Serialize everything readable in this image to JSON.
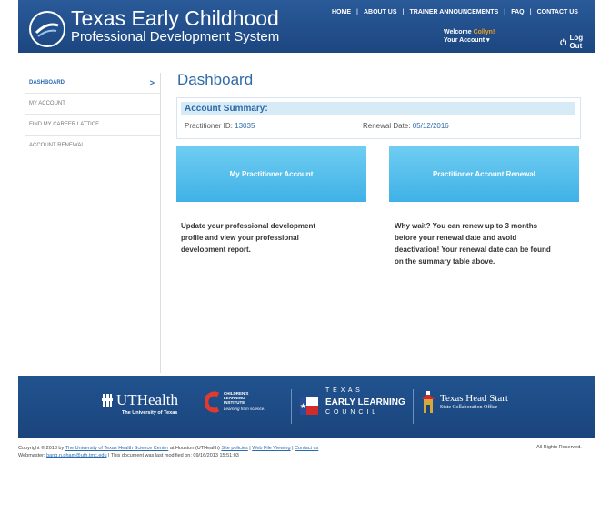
{
  "header": {
    "title": "Texas Early Childhood",
    "subtitle": "Professional Development System",
    "nav": [
      "HOME",
      "ABOUT US",
      "TRAINER ANNOUNCEMENTS",
      "FAQ",
      "CONTACT US"
    ],
    "welcome_label": "Welcome",
    "user_name": "Collyn!",
    "account_label": "Your Account ▾",
    "logout_label": "Log Out"
  },
  "sidebar": {
    "items": [
      {
        "label": "DASHBOARD",
        "active": true
      },
      {
        "label": "MY ACCOUNT",
        "active": false
      },
      {
        "label": "FIND MY CAREER LATTICE",
        "active": false
      },
      {
        "label": "ACCOUNT RENEWAL",
        "active": false
      }
    ],
    "active_arrow": ">"
  },
  "main": {
    "title": "Dashboard",
    "summary": {
      "heading": "Account Summary:",
      "pid_label": "Practitioner ID:",
      "pid_value": "13035",
      "renewal_label": "Renewal Date:",
      "renewal_value": "05/12/2016"
    },
    "buttons": {
      "account": "My Practitioner Account",
      "renewal": "Practitioner Account Renewal"
    },
    "desc_left": [
      "Update your professional development",
      "profile and view your professional",
      "development report."
    ],
    "desc_right": [
      "Why wait? You can renew up to 3 months",
      "before your renewal date and avoid",
      "deactivation! Your renewal date can be found",
      "on the summary table above."
    ]
  },
  "footer": {
    "uthealth": "UTHealth",
    "uthealth_sub": "The University of Texas",
    "cli_1": "CHILDREN'S",
    "cli_2": "LEARNING",
    "cli_3": "INSTITUTE",
    "cli_tag": "Learning from science.",
    "texas_spaced": "T E X A S",
    "elc": "EARLY LEARNING",
    "council_spaced": "C O U N C I L",
    "headstart": "Texas Head Start",
    "headstart_sub": "State Collaboration Office",
    "copyright_1a": "Copyright © 2013 by",
    "copyright_link": "The University of Texas Health Science Center",
    "copyright_1b": "at Houston (UTHealth)",
    "policies_link": "Site policies",
    "webfile_link": "Web File Viewing",
    "contact_link": "Contact us",
    "webmaster_label": "Webmaster:",
    "webmaster_email": "bang.n.pham@uth.tmc.edu",
    "modified": "| This document was last modified on: 09/16/2013 15:51:03",
    "rights": "All Rights Reserved."
  },
  "colors": {
    "header_blue": "#1f4e8c",
    "link_blue": "#2d6aa9",
    "button_cyan": "#3fb1e6",
    "summary_bg": "#d7ebf7"
  }
}
